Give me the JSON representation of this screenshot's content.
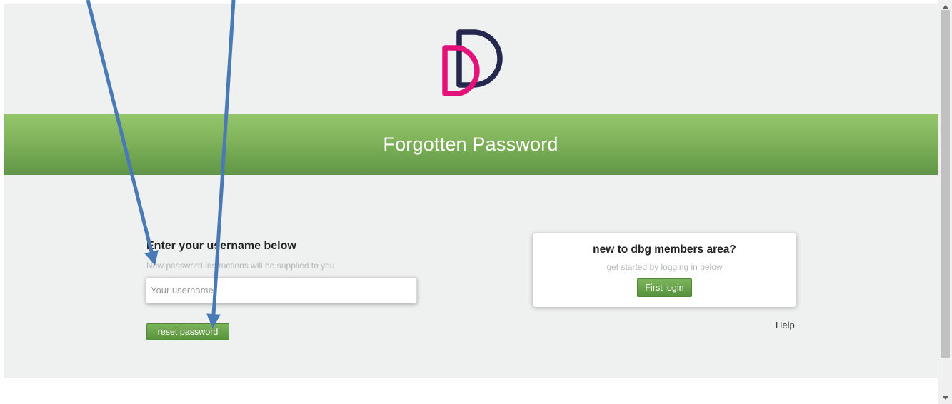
{
  "header": {
    "logo": "dbg-dd-logo",
    "title": "Forgotten Password"
  },
  "reset_form": {
    "heading": "Enter your username below",
    "subtext": "New password instructions will be supplied to you.",
    "username_placeholder": "Your username",
    "username_value": "",
    "submit_label": "reset password"
  },
  "new_user_card": {
    "title": "new to dbg members area?",
    "subtext": "get started by logging in below",
    "button_label": "First login"
  },
  "help_link": "Help",
  "colors": {
    "banner_green": "#7fb25a",
    "button_green": "#56913c",
    "logo_navy": "#25274e",
    "logo_pink": "#e3127b",
    "arrow_blue": "#4a7ab6"
  },
  "icons": {
    "scroll_up": "triangle-up",
    "scroll_down": "triangle-down"
  }
}
